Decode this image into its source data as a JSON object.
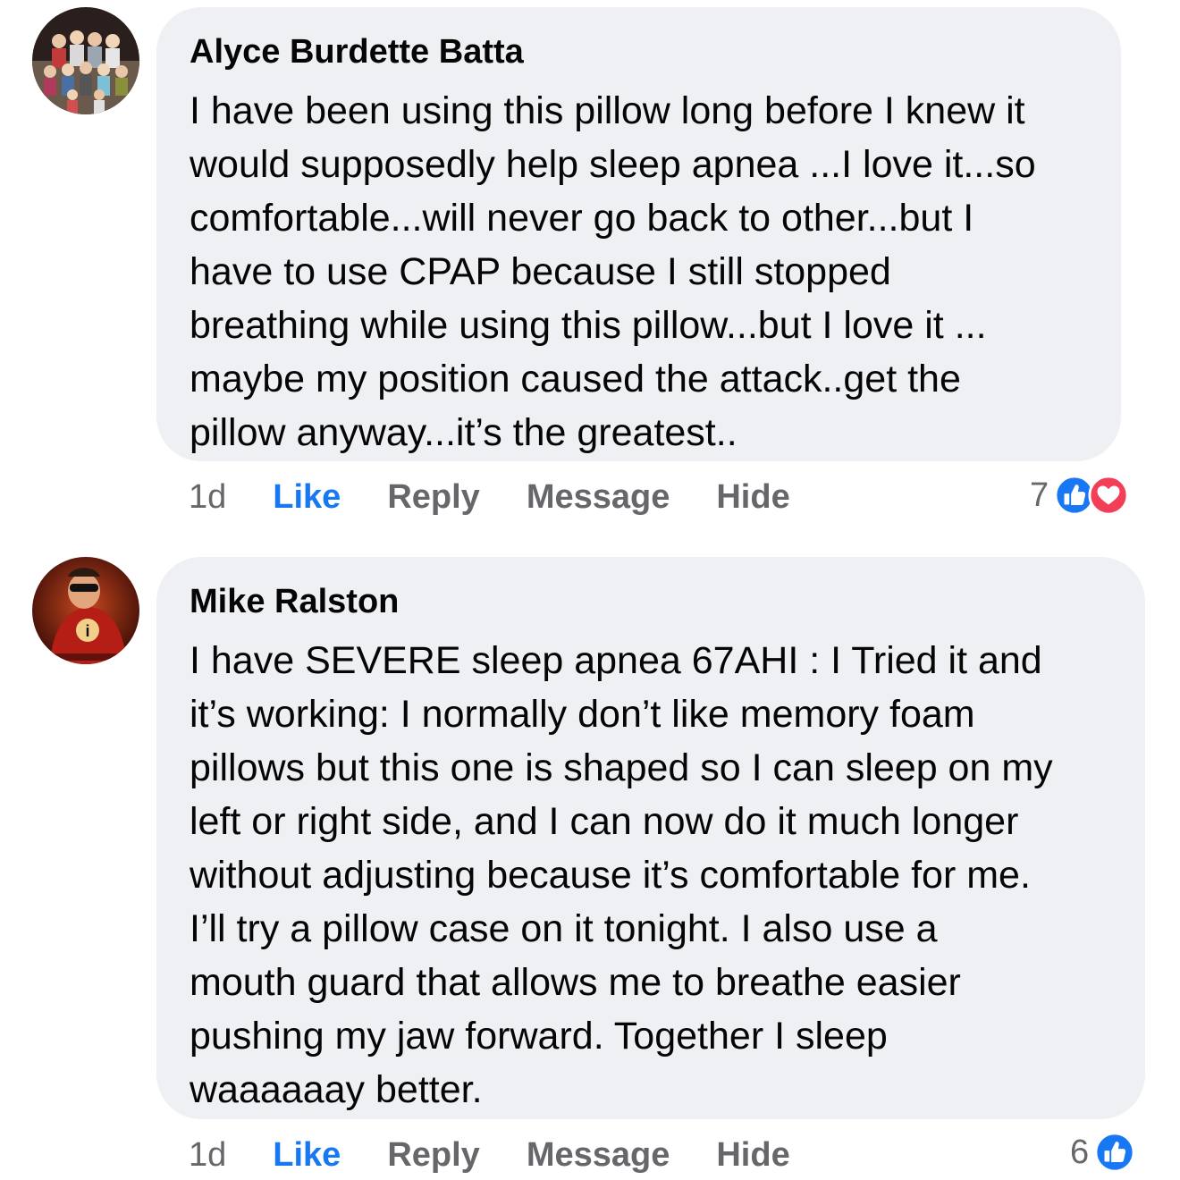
{
  "comments": [
    {
      "author": "Alyce Burdette Batta",
      "text": "I have been using this pillow long before I knew it\nwould supposedly help sleep apnea ...I love it...so\ncomfortable...will never go back to other...but I\nhave to use CPAP because I still stopped\nbreathing while using this pillow...but I love it ...\nmaybe my position caused the attack..get the\npillow anyway...it’s the greatest..",
      "time": "1d",
      "actions": {
        "like": "Like",
        "reply": "Reply",
        "message": "Message",
        "hide": "Hide"
      },
      "reaction_count": "7",
      "reactions": [
        "like-icon",
        "love-icon"
      ],
      "avatar": "group-photo-avatar"
    },
    {
      "author": "Mike Ralston",
      "text": "I have SEVERE sleep apnea 67AHI : I Tried it and\nit’s working: I normally don’t like memory foam\npillows but this one is shaped so I can sleep on my\nleft or right side, and I can now do it much longer\nwithout adjusting because it’s comfortable for me.\nI’ll try a pillow case on it tonight. I also use a\nmouth guard that allows me to breathe easier\npushing my jaw forward. Together I sleep\nwaaaaaay better.",
      "time": "1d",
      "actions": {
        "like": "Like",
        "reply": "Reply",
        "message": "Message",
        "hide": "Hide"
      },
      "reaction_count": "6",
      "reactions": [
        "like-icon"
      ],
      "avatar": "incredibles-avatar"
    }
  ],
  "colors": {
    "like_blue": "#1877f2",
    "love_red": "#f33e58",
    "bubble": "#eff0f3",
    "meta_gray": "#65676b"
  }
}
